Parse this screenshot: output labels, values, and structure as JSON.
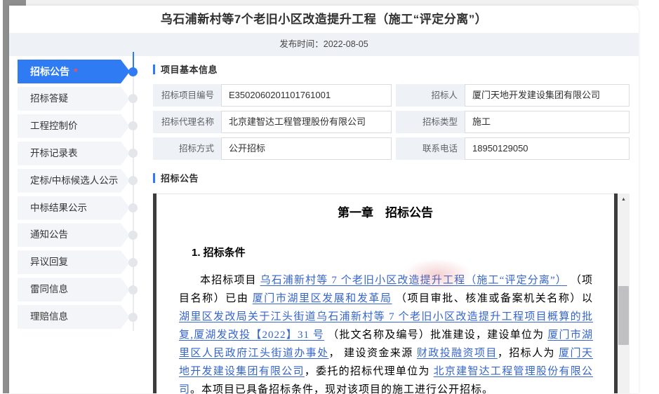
{
  "header": {
    "title": "乌石浦新村等7个老旧小区改造提升工程（施工“评定分离”）",
    "publish_time": "发布时间：2022-08-05"
  },
  "sidebar": {
    "items": [
      {
        "label": "招标公告",
        "active": true,
        "star": "*"
      },
      {
        "label": "招标答疑"
      },
      {
        "label": "工程控制价"
      },
      {
        "label": "开标记录表"
      },
      {
        "label": "定标/中标候选人公示"
      },
      {
        "label": "中标结果公示"
      },
      {
        "label": "通知公告"
      },
      {
        "label": "异议回复"
      },
      {
        "label": "雷同信息"
      },
      {
        "label": "理赔信息"
      }
    ]
  },
  "basic_info": {
    "section_title": "项目基本信息",
    "fields": [
      {
        "label": "招标项目编号",
        "value": "E3502060201101761001"
      },
      {
        "label": "招标人",
        "value": "厦门天地开发建设集团有限公司"
      },
      {
        "label": "招标代理名称",
        "value": "北京建智达工程管理股份有限公司"
      },
      {
        "label": "招标类型",
        "value": "施工"
      },
      {
        "label": "招标方式",
        "value": "公开招标"
      },
      {
        "label": "联系电话",
        "value": "18950129050"
      }
    ]
  },
  "announcement": {
    "section_title": "招标公告",
    "doc_title": "第一章　招标公告",
    "doc_heading": "1. 招标条件",
    "paragraph": [
      {
        "text": "本招标项目 "
      },
      {
        "text": "乌石浦新村等 7 个老旧小区改造提升工程（施工“评定分离”）",
        "link": true
      },
      {
        "text": " （项目名称）已由 "
      },
      {
        "text": "厦门市湖里区发展和发革局",
        "link": true
      },
      {
        "text": " （项目审批、核准或备案机关名称）以 "
      },
      {
        "text": "湖里区发改局关于江头街道乌石浦新村等 7 个老旧小区改造提升工程项目概算的批复,厦湖发改投【2022】31 号",
        "link": true
      },
      {
        "text": " （批文名称及编号）批准建设，建设单位为 "
      },
      {
        "text": "厦门市湖里区人民政府江头街道办事处",
        "link": true
      },
      {
        "text": "， 建设资金来源 "
      },
      {
        "text": "财政投融资项目",
        "link": true
      },
      {
        "text": "，招标人为 "
      },
      {
        "text": "厦门天地开发建设集团有限公司",
        "link": true
      },
      {
        "text": "，委托的招标代理单位为 "
      },
      {
        "text": "北京建智达工程管理股份有限公司",
        "link": true
      },
      {
        "text": "。本项目已具备招标条件，现对该项目的施工进行公开招标。"
      }
    ]
  },
  "icons": {
    "scroll_up_icon": "▲"
  },
  "colors": {
    "accent": "#2e7bf4",
    "link": "#3565cd",
    "star": "#ff4d4f",
    "doc_border": "#3c3c3c"
  }
}
